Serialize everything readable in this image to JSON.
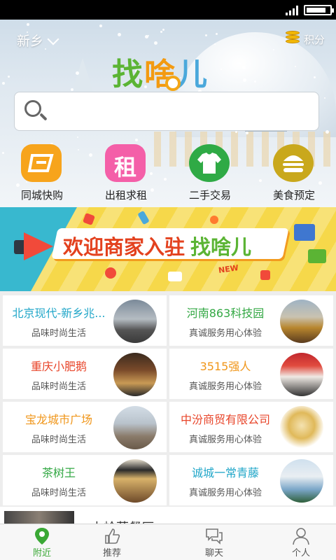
{
  "status_bar": {
    "battery_level": 0.85
  },
  "header": {
    "city": "新乡",
    "points_label": "积分",
    "logo_text": [
      "找",
      "啥",
      "儿"
    ]
  },
  "categories": [
    {
      "label": "同城快购",
      "icon": "shopping-bag-icon",
      "color": "#f7a41c"
    },
    {
      "label": "出租求租",
      "icon": "rent-sign-icon",
      "color": "#f45fa8",
      "glyph": "租"
    },
    {
      "label": "二手交易",
      "icon": "tshirt-icon",
      "color": "#2faa45"
    },
    {
      "label": "美食预定",
      "icon": "burger-icon",
      "color": "#c9a81c"
    }
  ],
  "banner": {
    "title": "欢迎商家入驻",
    "brand": "找啥儿",
    "badge": "NEW"
  },
  "merchants": [
    {
      "name": "北京现代-新乡兆...",
      "subtitle": "品味时尚生活",
      "color": "#22a7c9",
      "pic": "dealership-photo"
    },
    {
      "name": "河南863科技园",
      "subtitle": "真诚服务用心体验",
      "color": "#33a844",
      "pic": "tech-park-photo"
    },
    {
      "name": "重庆小肥鹅",
      "subtitle": "品味时尚生活",
      "color": "#e8452a",
      "pic": "restaurant-photo"
    },
    {
      "name": "3515强人",
      "subtitle": "真诚服务用心体验",
      "color": "#f0961a",
      "pic": "shoe-store-photo"
    },
    {
      "name": "宝龙城市广场",
      "subtitle": "品味时尚生活",
      "color": "#f0961a",
      "pic": "mall-photo"
    },
    {
      "name": "中汾商贸有限公司",
      "subtitle": "真诚服务用心体验",
      "color": "#e8452a",
      "pic": "liquor-bottle-photo"
    },
    {
      "name": "茶树王",
      "subtitle": "品味时尚生活",
      "color": "#33a844",
      "pic": "tea-shop-photo"
    },
    {
      "name": "诚城一常青藤",
      "subtitle": "真诚服务用心体验",
      "color": "#22a7c9",
      "pic": "residential-building-photo"
    }
  ],
  "peek_item": {
    "text": "上岭菜餐厅"
  },
  "tabs": [
    {
      "label": "附近",
      "icon": "location-pin-icon",
      "active": true
    },
    {
      "label": "推荐",
      "icon": "thumbs-up-icon",
      "active": false
    },
    {
      "label": "聊天",
      "icon": "chat-bubble-icon",
      "active": false
    },
    {
      "label": "个人",
      "icon": "person-icon",
      "active": false
    }
  ],
  "colors": {
    "accent": "#3aa835",
    "banner_yellow": "#f6d84a",
    "banner_teal": "#38b8cf"
  }
}
